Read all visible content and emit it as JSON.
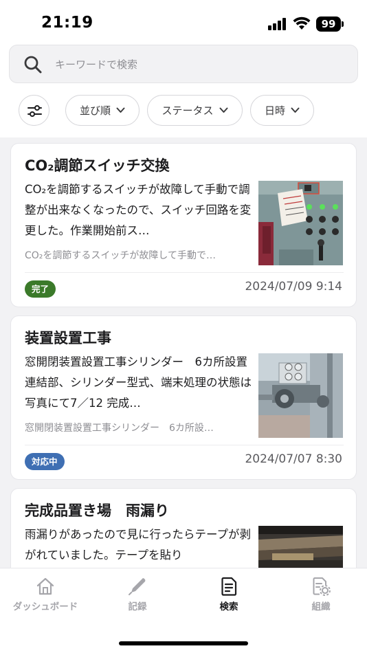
{
  "status_bar": {
    "time": "21:19",
    "battery": "99"
  },
  "search": {
    "placeholder": "キーワードで検索"
  },
  "filters": {
    "sort_label": "並び順",
    "status_label": "ステータス",
    "date_label": "日時"
  },
  "reports": [
    {
      "title": "CO₂調節スイッチ交換",
      "description": "CO₂を調節するスイッチが故障して手動で調整が出来なくなったので、スイッチ回路を変更した。作業開始前ス…",
      "preview": "CO₂を調節するスイッチが故障して手動で…",
      "status": "完了",
      "status_color": "#3b7a2a",
      "datetime": "2024/07/09 9:14",
      "thumbnail": "control-panel-photo"
    },
    {
      "title": "装置設置工事",
      "description": "窓開閉装置設置工事シリンダー　6カ所設置連結部、シリンダー型式、端末処理の状態は写真にて7／12 完成…",
      "preview": "窓開閉装置設置工事シリンダー　6カ所設…",
      "status": "対応中",
      "status_color": "#3f6fb3",
      "datetime": "2024/07/07 8:30",
      "thumbnail": "cylinder-mount-photo"
    },
    {
      "title": "完成品置き場　雨漏り",
      "description": "雨漏りがあったので見に行ったらテープが剥がれていました。テープを貼り",
      "preview": "",
      "status": "",
      "status_color": "#3b7a2a",
      "datetime": "",
      "thumbnail": "roof-photo"
    }
  ],
  "tabs": [
    {
      "label": "ダッシュボード",
      "icon": "home-icon"
    },
    {
      "label": "記録",
      "icon": "pen-icon"
    },
    {
      "label": "検索",
      "icon": "document-search-icon"
    },
    {
      "label": "組織",
      "icon": "organization-gear-icon"
    }
  ],
  "colors": {
    "accent_done": "#3b7a2a",
    "accent_in_progress": "#3f6fb3",
    "tab_active": "#1c1c1e",
    "tab_inactive": "#a6a6ab"
  }
}
